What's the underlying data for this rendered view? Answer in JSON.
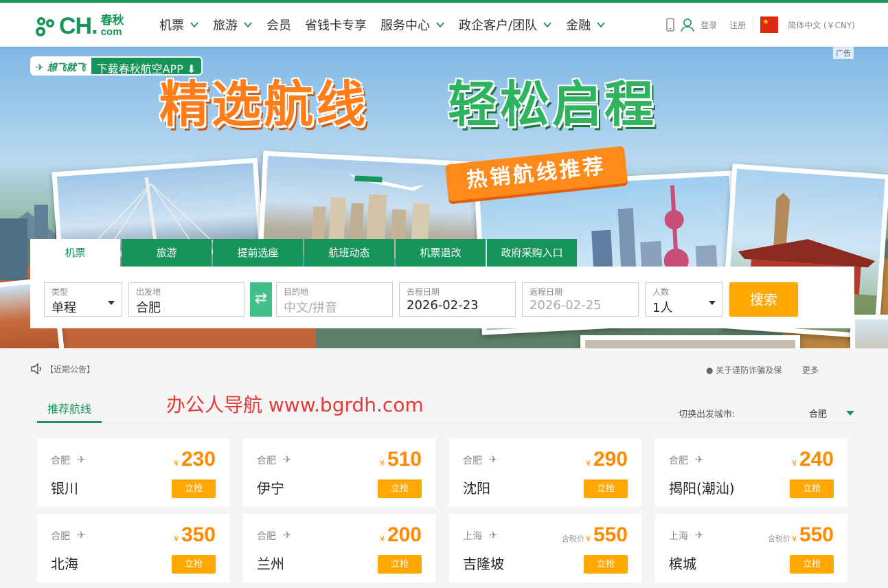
{
  "header": {
    "logo_ch": "CH.",
    "logo_cn": "春秋",
    "logo_com": "com",
    "nav": [
      {
        "label": "机票",
        "dropdown": true
      },
      {
        "label": "旅游",
        "dropdown": true
      },
      {
        "label": "会员",
        "dropdown": false
      },
      {
        "label": "省钱卡专享",
        "dropdown": false
      },
      {
        "label": "服务中心",
        "dropdown": true
      },
      {
        "label": "政企客户/团队",
        "dropdown": true
      },
      {
        "label": "金融",
        "dropdown": true
      }
    ],
    "login": "登录",
    "register": "注册",
    "language": "简体中文 (￥CNY)"
  },
  "banner": {
    "ad_label": "广告",
    "app_slogan": "想飞就飞",
    "app_download": "下载春秋航空APP",
    "headline_1": "精选航线",
    "headline_2": "轻松启程",
    "ribbon": "热销航线推荐"
  },
  "search": {
    "tabs": [
      "机票",
      "旅游",
      "提前选座",
      "航班动态",
      "机票退改",
      "政府采购入口"
    ],
    "active_tab": "机票",
    "type_label": "类型",
    "type_value": "单程",
    "from_label": "出发地",
    "from_value": "合肥",
    "to_label": "目的地",
    "to_placeholder": "中文/拼音",
    "depart_label": "去程日期",
    "depart_value": "2026-02-23",
    "return_label": "返程日期",
    "return_value": "2026-02-25",
    "pax_label": "人数",
    "pax_value": "1人",
    "search_button": "搜索"
  },
  "notice": {
    "label": "【近期公告】",
    "item": "关于谨防诈骗及保",
    "more": "更多"
  },
  "recommend": {
    "tab": "推荐航线",
    "watermark": "办公人导航  www.bgrdh.com",
    "switch_label": "切换出发城市:",
    "city": "合肥",
    "buy_label": "立抢",
    "currency": "¥",
    "routes": [
      {
        "from": "合肥",
        "to": "银川",
        "tax": "",
        "price": "230"
      },
      {
        "from": "合肥",
        "to": "伊宁",
        "tax": "",
        "price": "510"
      },
      {
        "from": "合肥",
        "to": "沈阳",
        "tax": "",
        "price": "290"
      },
      {
        "from": "合肥",
        "to": "揭阳(潮汕)",
        "tax": "",
        "price": "240"
      },
      {
        "from": "合肥",
        "to": "北海",
        "tax": "",
        "price": "350"
      },
      {
        "from": "合肥",
        "to": "兰州",
        "tax": "",
        "price": "200"
      },
      {
        "from": "上海",
        "to": "吉隆坡",
        "tax": "含税价",
        "price": "550"
      },
      {
        "from": "上海",
        "to": "槟城",
        "tax": "含税价",
        "price": "550"
      }
    ]
  }
}
